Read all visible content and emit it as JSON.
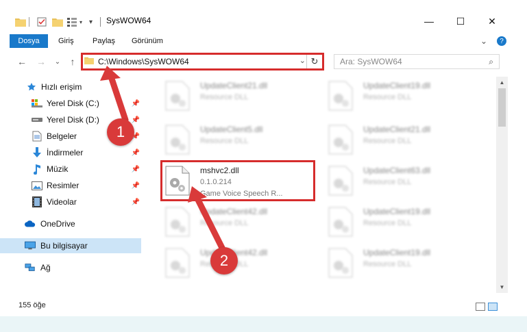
{
  "window": {
    "title": "SysWOW64",
    "minimize": "—",
    "maximize": "☐",
    "close": "✕"
  },
  "ribbon": {
    "tabs": [
      "Dosya",
      "Giriş",
      "Paylaş",
      "Görünüm"
    ],
    "expand": "⌄",
    "help": "?"
  },
  "address": {
    "path": "C:\\Windows\\SysWOW64",
    "back": "←",
    "forward": "→",
    "recent": "⌄",
    "up": "↑",
    "dropdown": "⌄",
    "refresh": "↻"
  },
  "search": {
    "placeholder": "Ara: SysWOW64",
    "icon": "⌕"
  },
  "sidebar": {
    "items": [
      {
        "label": "Hızlı erişim",
        "icon": "star-icon",
        "pinned": false
      },
      {
        "label": "Yerel Disk (C:)",
        "icon": "drive-icon",
        "pinned": true
      },
      {
        "label": "Yerel Disk (D:)",
        "icon": "drive-icon",
        "pinned": true
      },
      {
        "label": "Belgeler",
        "icon": "documents-icon",
        "pinned": true
      },
      {
        "label": "İndirmeler",
        "icon": "download-icon",
        "pinned": true
      },
      {
        "label": "Müzik",
        "icon": "music-icon",
        "pinned": true
      },
      {
        "label": "Resimler",
        "icon": "pictures-icon",
        "pinned": true
      },
      {
        "label": "Videolar",
        "icon": "video-icon",
        "pinned": true
      },
      {
        "label": "OneDrive",
        "icon": "cloud-icon",
        "pinned": false
      },
      {
        "label": "Bu bilgisayar",
        "icon": "computer-icon",
        "pinned": false,
        "selected": true
      },
      {
        "label": "Ağ",
        "icon": "network-icon",
        "pinned": false
      }
    ],
    "pin_glyph": "📌"
  },
  "files": {
    "left": [
      {
        "name": "UpdateClient21.dll",
        "desc": "Resource DLL"
      },
      {
        "name": "UpdateClient5.dll",
        "desc": "Resource DLL"
      },
      {
        "name": "mshvc2.dll",
        "desc": "0.1.0.214",
        "sub": "Game Voice Speech R..."
      },
      {
        "name": "UpdateClient42.dll",
        "desc": "Resource DLL"
      },
      {
        "name": "UpdateClient42.dll",
        "desc": "Resource DLL"
      }
    ],
    "right": [
      {
        "name": "UpdateClient19.dll",
        "desc": "Resource DLL"
      },
      {
        "name": "UpdateClient21.dll",
        "desc": "Resource DLL"
      },
      {
        "name": "UpdateClient63.dll",
        "desc": "Resource DLL"
      },
      {
        "name": "UpdateClient19.dll",
        "desc": "Resource DLL"
      },
      {
        "name": "UpdateClient19.dll",
        "desc": "Resource DLL"
      }
    ]
  },
  "status": {
    "count": "155 öğe"
  },
  "callouts": [
    "1",
    "2"
  ],
  "colors": {
    "accent": "#1979ca",
    "highlight": "#d62c2c",
    "callout": "#d93a3a",
    "selected": "#cce4f7"
  }
}
